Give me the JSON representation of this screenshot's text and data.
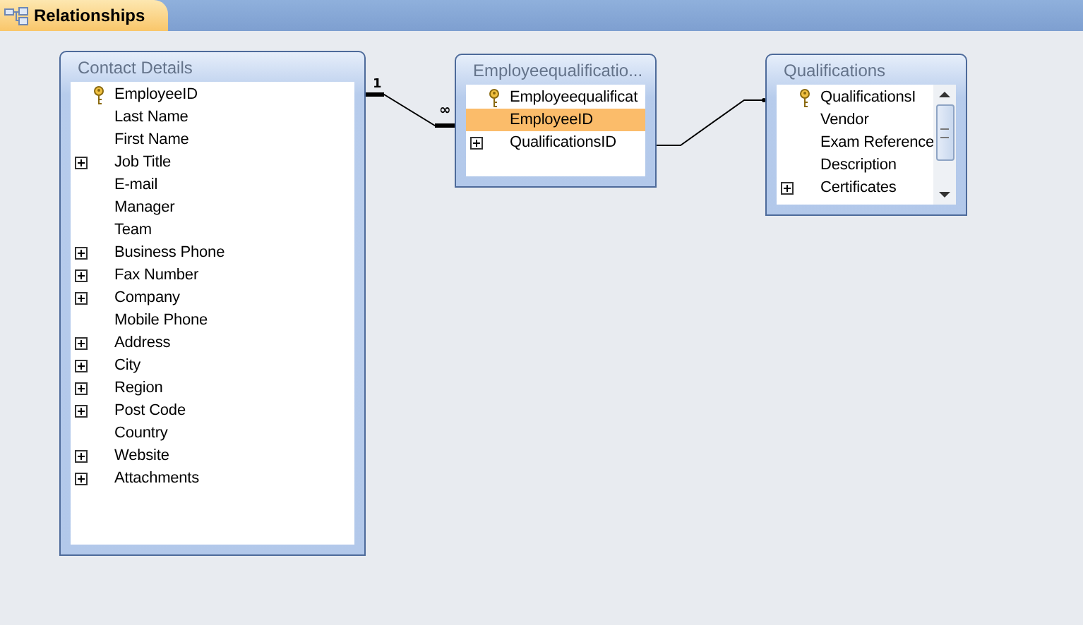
{
  "tab": {
    "label": "Relationships",
    "selected": true
  },
  "tables": [
    {
      "title": "Contact Details",
      "scroll": false,
      "fields": [
        {
          "name": "EmployeeID",
          "kind": "key",
          "selected": false
        },
        {
          "name": "Last Name",
          "kind": "plain",
          "selected": false
        },
        {
          "name": "First Name",
          "kind": "plain",
          "selected": false
        },
        {
          "name": "Job Title",
          "kind": "multivalue",
          "selected": false
        },
        {
          "name": "E-mail",
          "kind": "plain",
          "selected": false
        },
        {
          "name": "Manager",
          "kind": "plain",
          "selected": false
        },
        {
          "name": "Team",
          "kind": "plain",
          "selected": false
        },
        {
          "name": "Business Phone",
          "kind": "multivalue",
          "selected": false
        },
        {
          "name": "Fax Number",
          "kind": "multivalue",
          "selected": false
        },
        {
          "name": "Company",
          "kind": "multivalue",
          "selected": false
        },
        {
          "name": "Mobile Phone",
          "kind": "plain",
          "selected": false
        },
        {
          "name": "Address",
          "kind": "multivalue",
          "selected": false
        },
        {
          "name": "City",
          "kind": "multivalue",
          "selected": false
        },
        {
          "name": "Region",
          "kind": "multivalue",
          "selected": false
        },
        {
          "name": "Post Code",
          "kind": "multivalue",
          "selected": false
        },
        {
          "name": "Country",
          "kind": "plain",
          "selected": false
        },
        {
          "name": "Website",
          "kind": "multivalue",
          "selected": false
        },
        {
          "name": "Attachments",
          "kind": "multivalue",
          "selected": false
        }
      ]
    },
    {
      "title": "Employeequalificatio...",
      "scroll": false,
      "fields": [
        {
          "name": "Employeequalificat",
          "kind": "key",
          "selected": false
        },
        {
          "name": "EmployeeID",
          "kind": "plain",
          "selected": true
        },
        {
          "name": "QualificationsID",
          "kind": "multivalue",
          "selected": false
        }
      ]
    },
    {
      "title": "Qualifications",
      "scroll": true,
      "fields": [
        {
          "name": "QualificationsI",
          "kind": "key",
          "selected": false
        },
        {
          "name": "Vendor",
          "kind": "plain",
          "selected": false
        },
        {
          "name": "Exam Reference",
          "kind": "plain",
          "selected": false
        },
        {
          "name": "Description",
          "kind": "plain",
          "selected": false
        },
        {
          "name": "Certificates",
          "kind": "multivalue",
          "selected": false
        }
      ]
    }
  ],
  "relationships": [
    {
      "kind": "one-to-many",
      "one_label": "1",
      "many_label": "∞"
    },
    {
      "kind": "plain"
    }
  ]
}
